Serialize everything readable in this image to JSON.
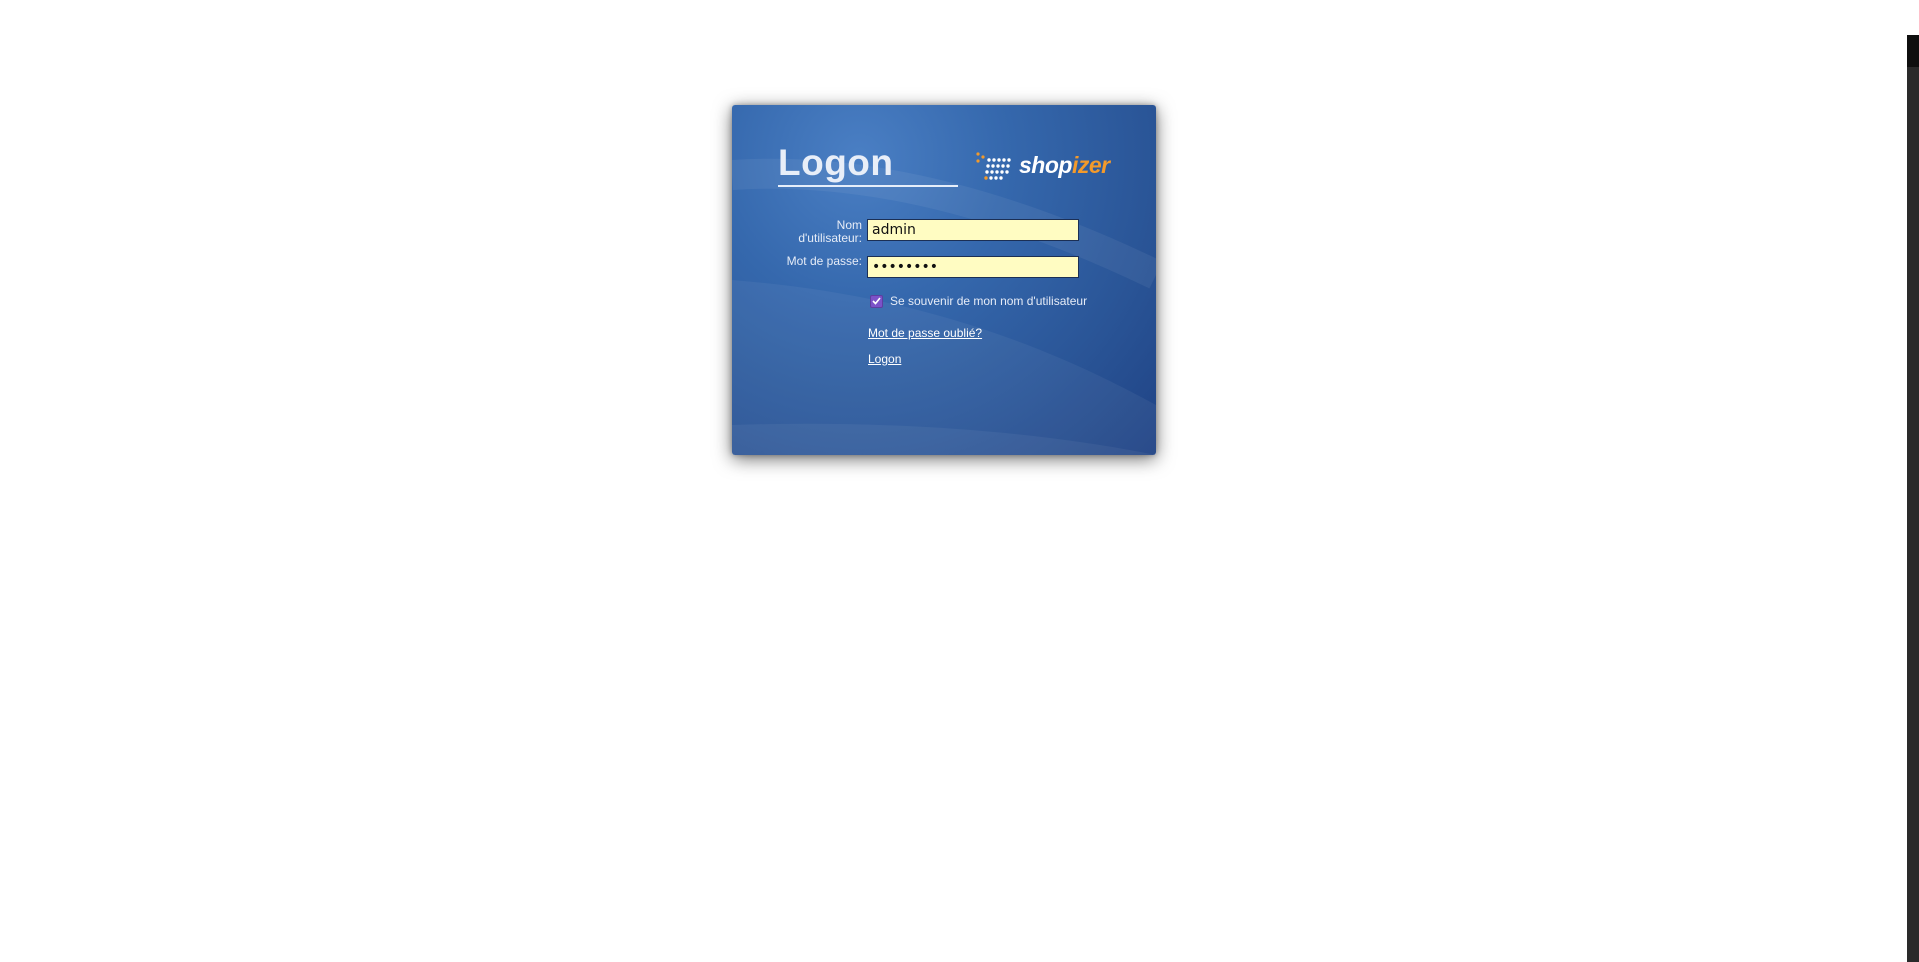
{
  "panel": {
    "title": "Logon",
    "logo": {
      "brand_part1": "shop",
      "brand_part2": "izer",
      "icon": "dotted-arrow-icon"
    }
  },
  "form": {
    "username": {
      "label": "Nom d'utilisateur:",
      "value": "admin"
    },
    "password": {
      "label": "Mot de passe:",
      "value": "••••••••"
    },
    "remember": {
      "label": "Se souvenir de mon nom d'utilisateur",
      "checked": true
    },
    "forgot_link": "Mot de passe oublié?",
    "logon_link": "Logon"
  },
  "colors": {
    "panel_blue": "#3568ad",
    "field_bg": "#fffcc2",
    "logo_orange": "#f39a2b",
    "checkbox": "#7b52c8"
  }
}
